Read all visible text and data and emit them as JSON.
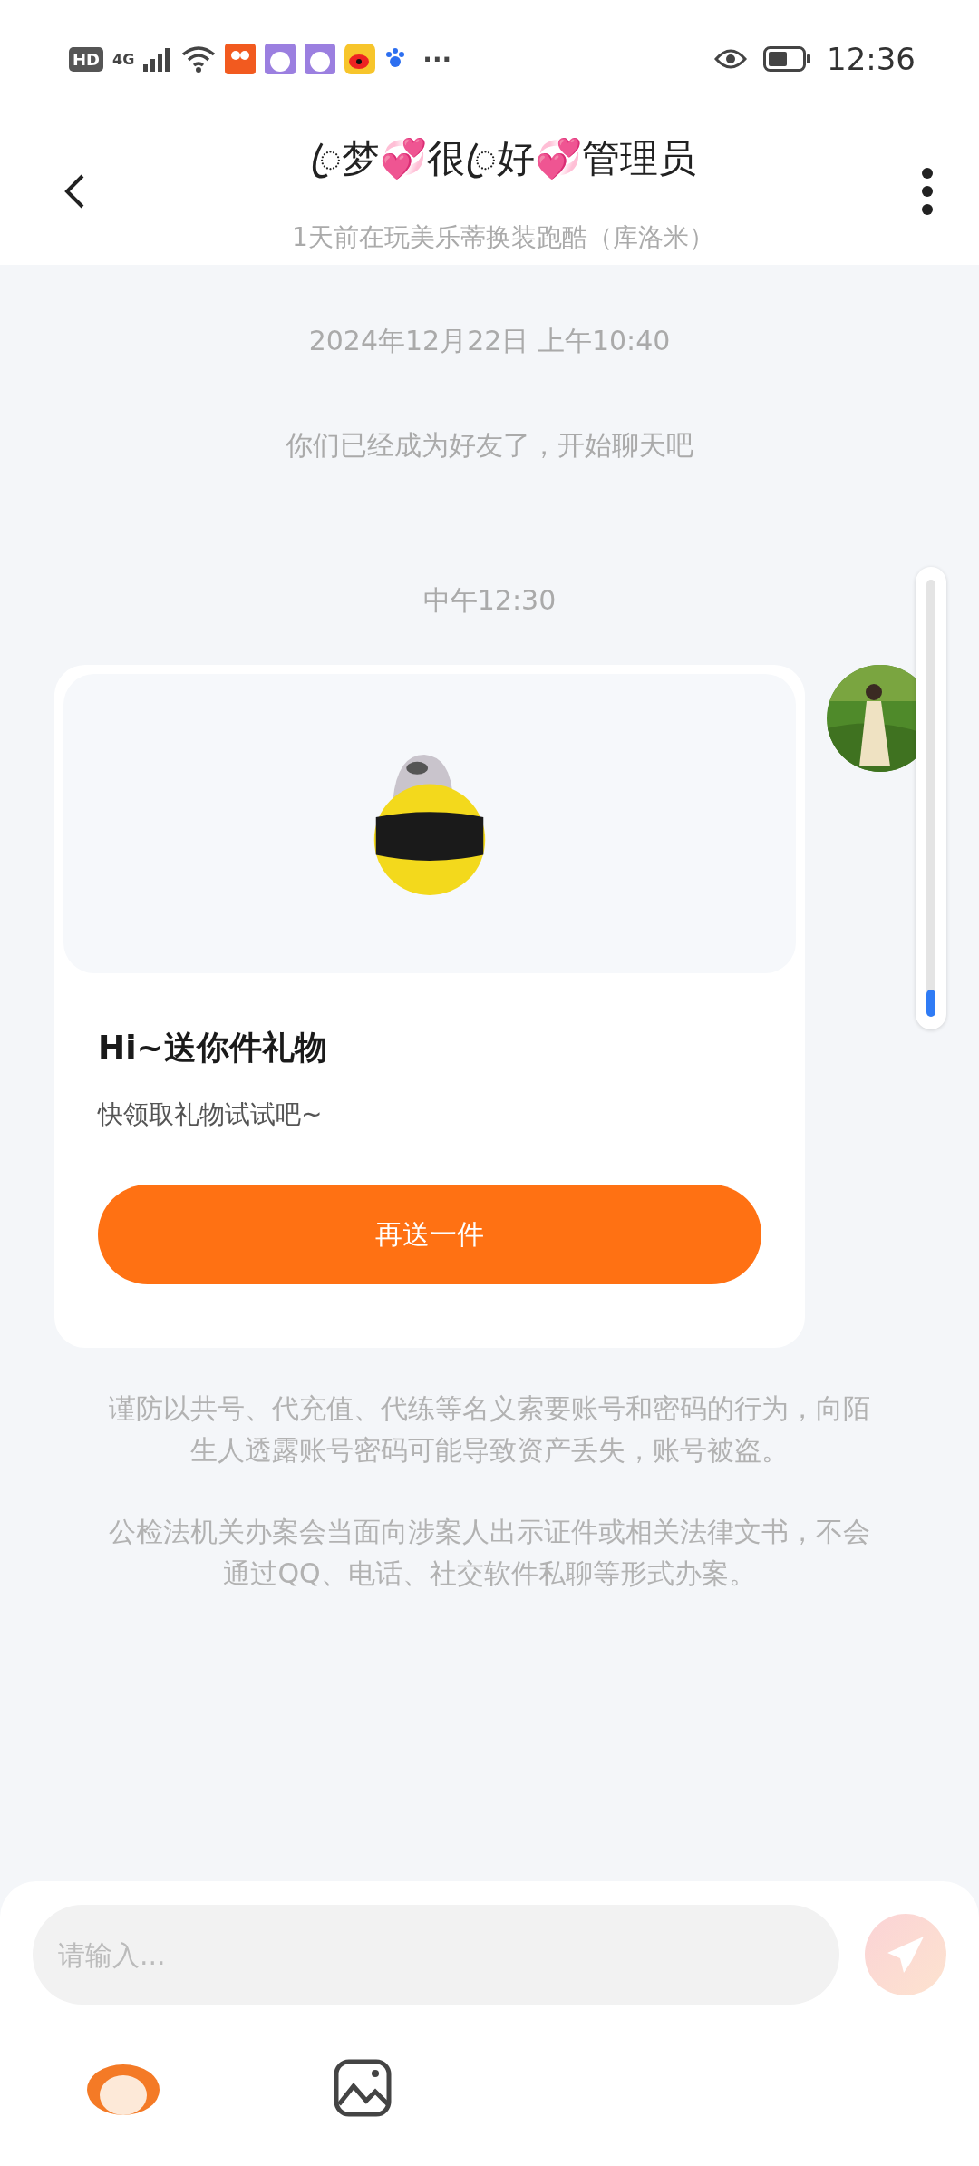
{
  "status_bar": {
    "left_items": [
      "HD",
      "4G",
      "···"
    ],
    "time": "12:36"
  },
  "header": {
    "title": "ꦿ梦💞很ꦿ好💞管理员",
    "subtitle": "1天前在玩美乐蒂换装跑酷（库洛米）"
  },
  "messages": [
    {
      "kind": "time",
      "text": "2024年12月22日 上午10:40"
    },
    {
      "kind": "notice",
      "text": "你们已经成为好友了，开始聊天吧"
    },
    {
      "kind": "time",
      "text": "中午12:30"
    },
    {
      "kind": "gift",
      "title": "Hi~送你件礼物",
      "subtitle": "快领取礼物试试吧~",
      "button": "再送一件"
    }
  ],
  "warnings": [
    "谨防以共号、代充值、代练等名义索要账号和密码的行为，向陌生人透露账号密码可能导致资产丢失，账号被盗。",
    "公检法机关办案会当面向涉案人出示证件或相关法律文书，不会通过QQ、电话、社交软件私聊等形式办案。"
  ],
  "composer": {
    "placeholder": "请输入..."
  }
}
